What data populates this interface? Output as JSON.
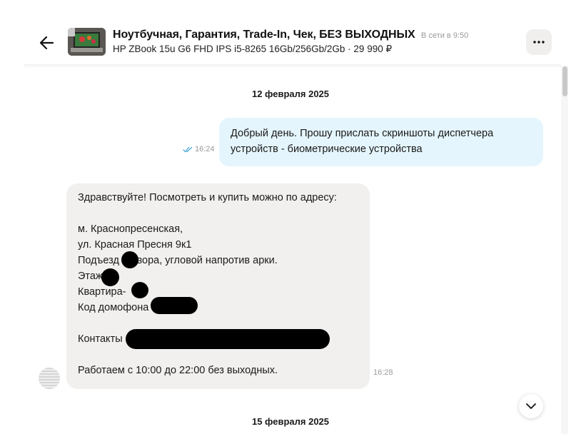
{
  "header": {
    "title": "Ноутбучная, Гарантия, Trade-In, Чек, БЕЗ ВЫХОДНЫХ",
    "online_status": "В сети в 9:50",
    "subtitle": "HP ZBook 15u G6 FHD IPS i5-8265 16Gb/256Gb/2Gb · 29 990 ₽",
    "icons": {
      "back": "arrow-left-icon",
      "menu": "more-dots-icon"
    }
  },
  "dates": {
    "first": "12 февраля 2025",
    "second": "15 февраля 2025"
  },
  "outgoing_message": {
    "lines": [
      "Добрый день. Прошу прислать скриншоты диспетчера",
      "устройств - биометрические устройства"
    ],
    "time": "16:24",
    "status_icon": "double-check-icon"
  },
  "incoming_message": {
    "lines": [
      "Здравствуйте! Посмотреть и купить можно по адресу:",
      "",
      "м. Краснопресенская,",
      "ул. Красная Пресня 9к1",
      "Подъезд   о двора, угловой напротив арки.",
      "Этаж",
      "Квартира-",
      "Код домофона",
      "",
      "Контакты",
      "",
      "Работаем с 10:00 до 22:00 без выходных."
    ],
    "time": "16:28"
  },
  "colors": {
    "outgoing_bubble": "#e5f5fd",
    "incoming_bubble": "#f1f0ee",
    "check_color": "#4aa8d8",
    "menu_button_bg": "#f0efed"
  }
}
